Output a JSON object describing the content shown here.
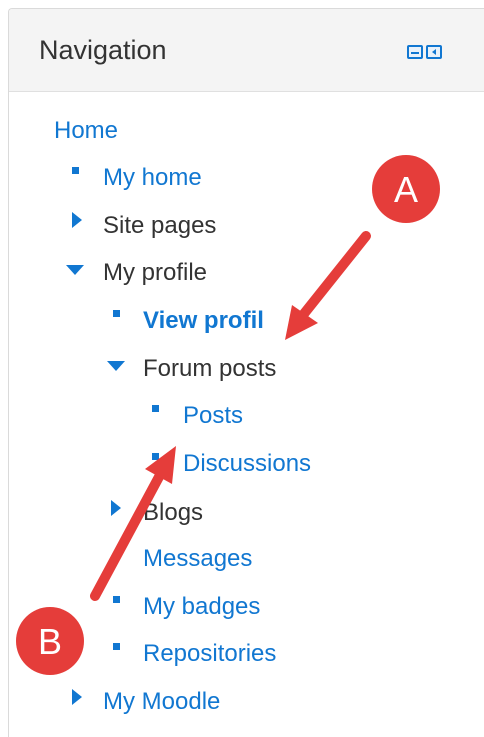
{
  "block": {
    "title": "Navigation",
    "minimize_icon": "minimize-icon",
    "dock_icon": "dock-icon"
  },
  "nav": {
    "home": "Home",
    "my_home": "My home",
    "site_pages": "Site pages",
    "my_profile": "My profile",
    "view_profile": "View profil",
    "forum_posts": "Forum posts",
    "posts": "Posts",
    "discussions": "Discussions",
    "blogs": "Blogs",
    "messages": "Messages",
    "my_badges": "My badges",
    "repositories": "Repositories",
    "my_moodle": "My Moodle"
  },
  "annotations": {
    "a_label": "A",
    "b_label": "B",
    "color": "#e53d3a"
  },
  "colors": {
    "link": "#1177d1",
    "text": "#333333",
    "header_bg": "#f4f4f4"
  }
}
